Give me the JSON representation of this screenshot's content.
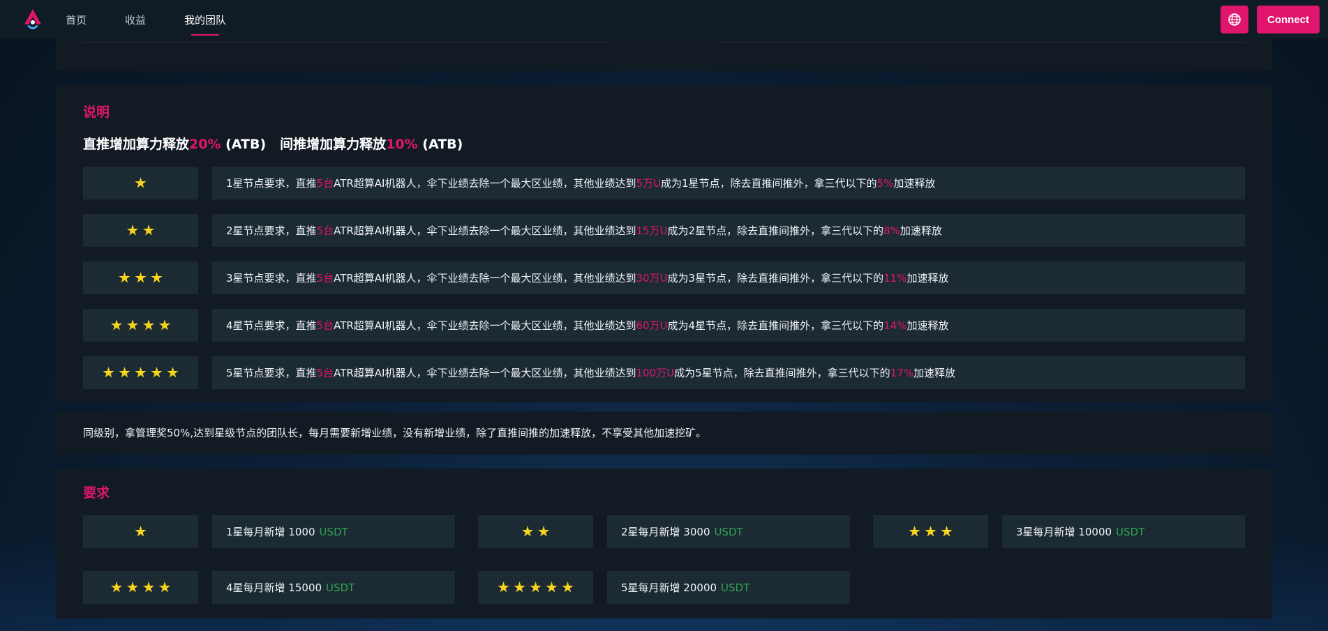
{
  "header": {
    "logo": "atr-logo-icon",
    "nav": [
      {
        "label": "首页",
        "active": false
      },
      {
        "label": "收益",
        "active": false
      },
      {
        "label": "我的团队",
        "active": true
      }
    ],
    "language_icon": "globe-icon",
    "connect_label": "Connect"
  },
  "colors": {
    "accent": "#e0156d",
    "star": "#f5d31f",
    "usdt": "#2ea44f",
    "panel": "#121b24",
    "cell": "#1c2a34"
  },
  "description": {
    "title": "说明",
    "headline": {
      "part1": "直推增加算力释放",
      "pct1": "20%",
      "unit1": "(ATB)",
      "part2": "间推增加算力释放",
      "pct2": "10%",
      "unit2": "(ATB)"
    },
    "rows": [
      {
        "stars": 1,
        "t1": "1星节点要求，直推",
        "p1": "5台",
        "t2": "ATR超算AI机器人，伞下业绩去除一个最大区业绩，其他业绩达到",
        "p2": "5万U",
        "t3": "成为1星节点，除去直推间推外，拿三代以下的",
        "p3": "5%",
        "t4": "加速释放"
      },
      {
        "stars": 2,
        "t1": "2星节点要求，直推",
        "p1": "5台",
        "t2": "ATR超算AI机器人，伞下业绩去除一个最大区业绩，其他业绩达到",
        "p2": "15万U",
        "t3": "成为2星节点，除去直推间推外，拿三代以下的",
        "p3": "8%",
        "t4": "加速释放"
      },
      {
        "stars": 3,
        "t1": "3星节点要求，直推",
        "p1": "5台",
        "t2": "ATR超算AI机器人，伞下业绩去除一个最大区业绩，其他业绩达到",
        "p2": "30万U",
        "t3": "成为3星节点，除去直推间推外，拿三代以下的",
        "p3": "11%",
        "t4": "加速释放"
      },
      {
        "stars": 4,
        "t1": "4星节点要求，直推",
        "p1": "5台",
        "t2": "ATR超算AI机器人，伞下业绩去除一个最大区业绩，其他业绩达到",
        "p2": "60万U",
        "t3": "成为4星节点，除去直推间推外，拿三代以下的",
        "p3": "14%",
        "t4": "加速释放"
      },
      {
        "stars": 5,
        "t1": "5星节点要求，直推",
        "p1": "5台",
        "t2": "ATR超算AI机器人，伞下业绩去除一个最大区业绩，其他业绩达到",
        "p2": "100万U",
        "t3": "成为5星节点，除去直推间推外，拿三代以下的",
        "p3": "17%",
        "t4": "加速释放"
      }
    ]
  },
  "note": "同级别，拿管理奖50%,达到星级节点的团队长，每月需要新增业绩，没有新增业绩，除了直推间推的加速释放，不享受其他加速挖矿。",
  "requirements": {
    "title": "要求",
    "items": [
      {
        "stars": 1,
        "text": "1星每月新增 1000",
        "unit": "USDT"
      },
      {
        "stars": 2,
        "text": "2星每月新增 3000",
        "unit": "USDT"
      },
      {
        "stars": 3,
        "text": "3星每月新增 10000",
        "unit": "USDT"
      },
      {
        "stars": 4,
        "text": "4星每月新增 15000",
        "unit": "USDT"
      },
      {
        "stars": 5,
        "text": "5星每月新增 20000",
        "unit": "USDT"
      }
    ]
  }
}
